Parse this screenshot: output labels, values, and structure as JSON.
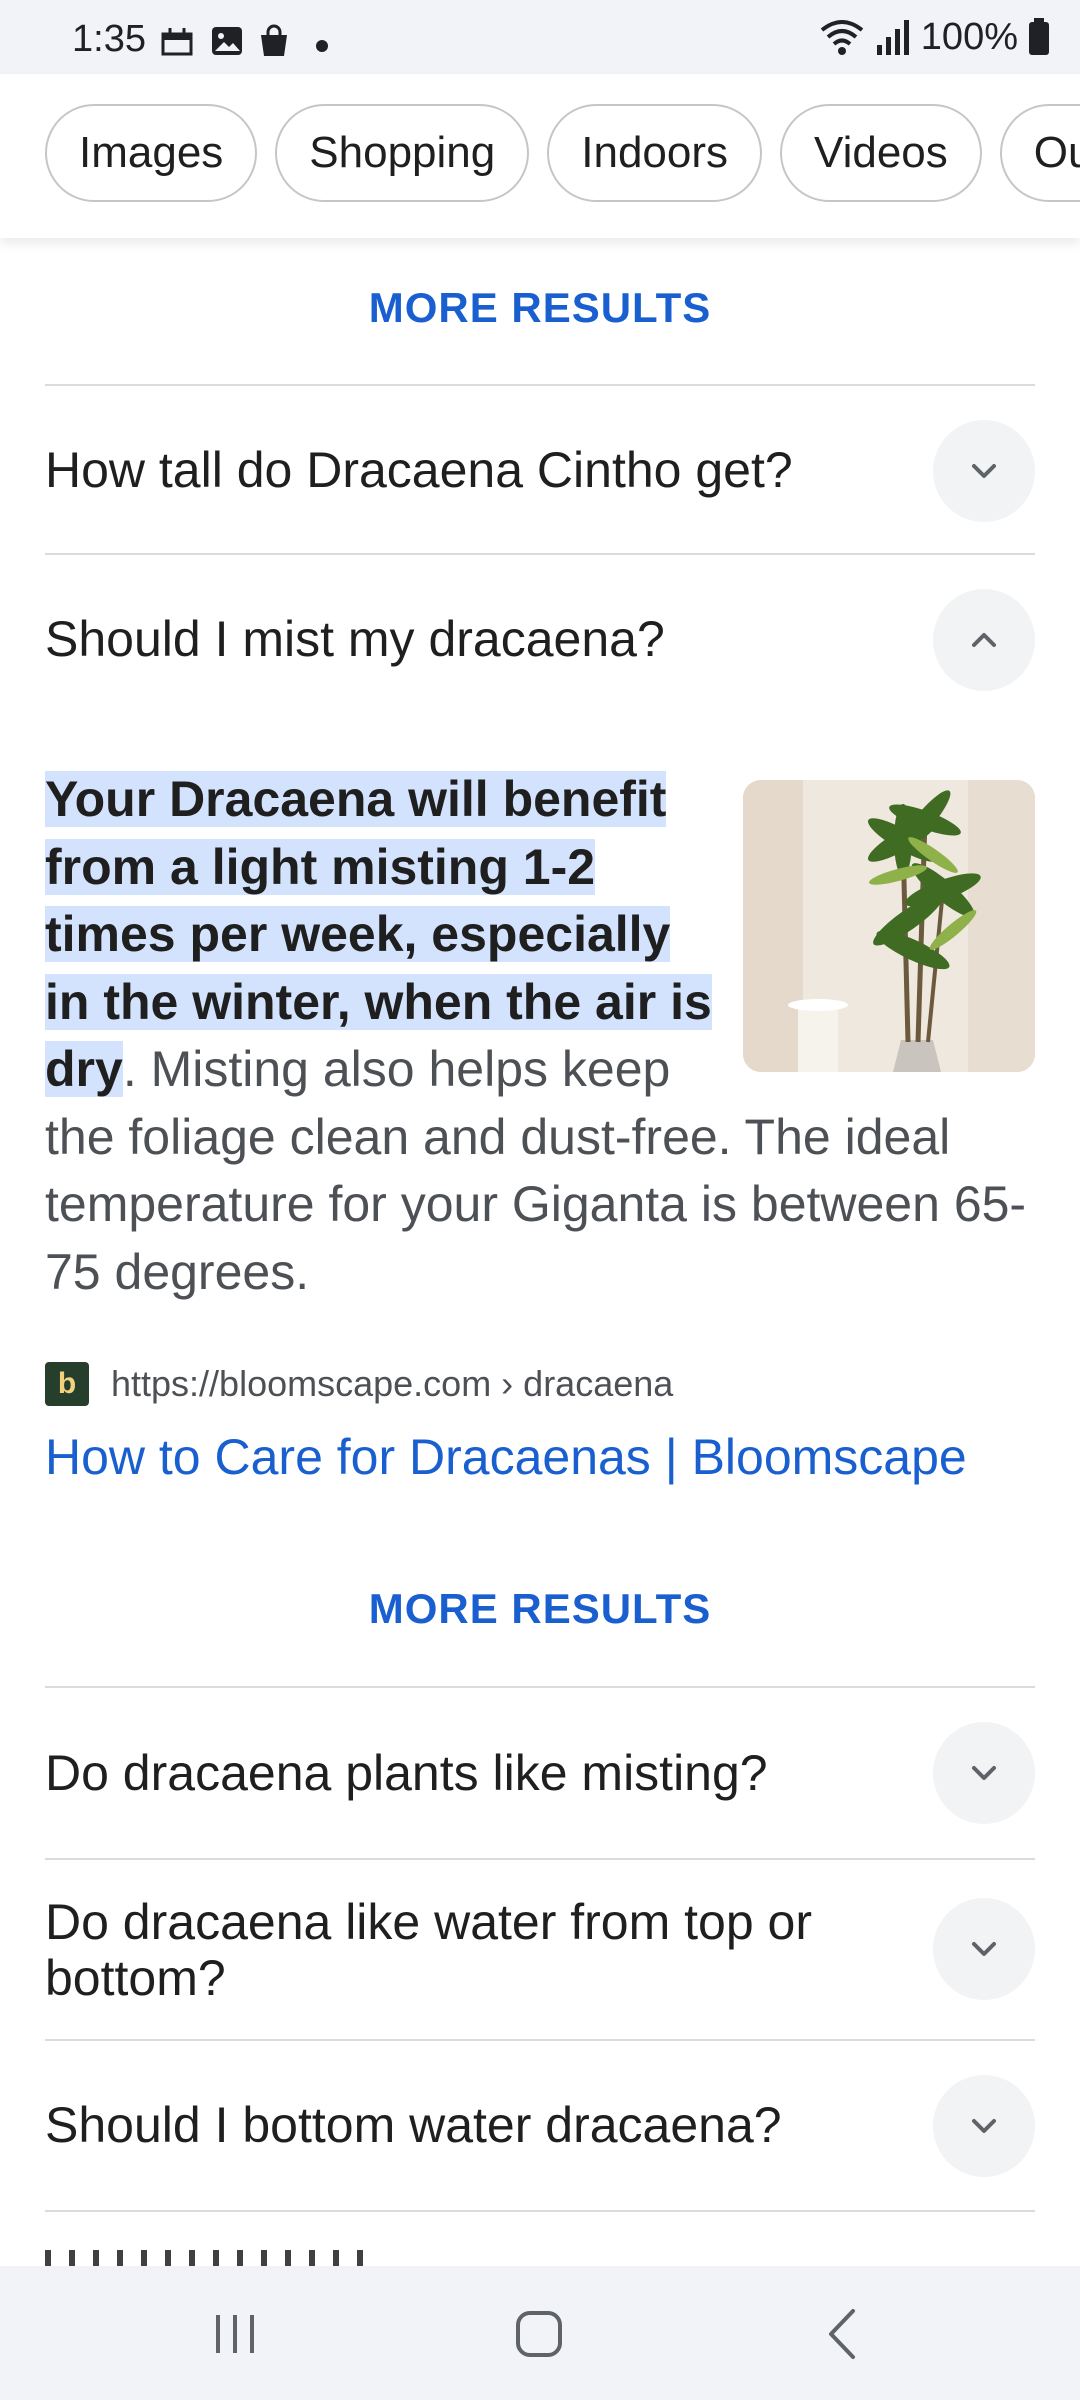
{
  "status_bar": {
    "time": "1:35",
    "battery": "100%",
    "icons": [
      "calendar-icon",
      "gallery-icon",
      "shopping-bag-icon",
      "dot-icon",
      "wifi-icon",
      "signal-icon",
      "battery-icon"
    ]
  },
  "chips": [
    {
      "label": "Images"
    },
    {
      "label": "Shopping"
    },
    {
      "label": "Indoors"
    },
    {
      "label": "Videos"
    },
    {
      "label": "Outd"
    }
  ],
  "faq": {
    "more_results_top": "MORE RESULTS",
    "q1": "How tall do Dracaena Cintho get?",
    "q2": "Should I mist my dracaena?",
    "answer_highlight": "Your Dracaena will benefit from a light misting 1-2 times per week, especially in the winter, when the air is dry",
    "answer_rest": ". Misting also helps keep the foliage clean and dust-free. The ideal temperature for your Giganta is between 65-75 degrees.",
    "source_favicon": "b",
    "source_url": "https://bloomscape.com › dracaena",
    "result_title": "How to Care for Dracaenas | Bloomscape",
    "more_results_bottom": "MORE RESULTS",
    "q3": "Do dracaena plants like misting?",
    "q4": "Do dracaena like water from top or bottom?",
    "q5": "Should I bottom water dracaena?"
  },
  "colors": {
    "link": "#1a5fcf",
    "highlight": "#d3e3fd",
    "bar": "#f1f3f8"
  },
  "nav": [
    "recents-icon",
    "home-icon",
    "back-icon"
  ]
}
